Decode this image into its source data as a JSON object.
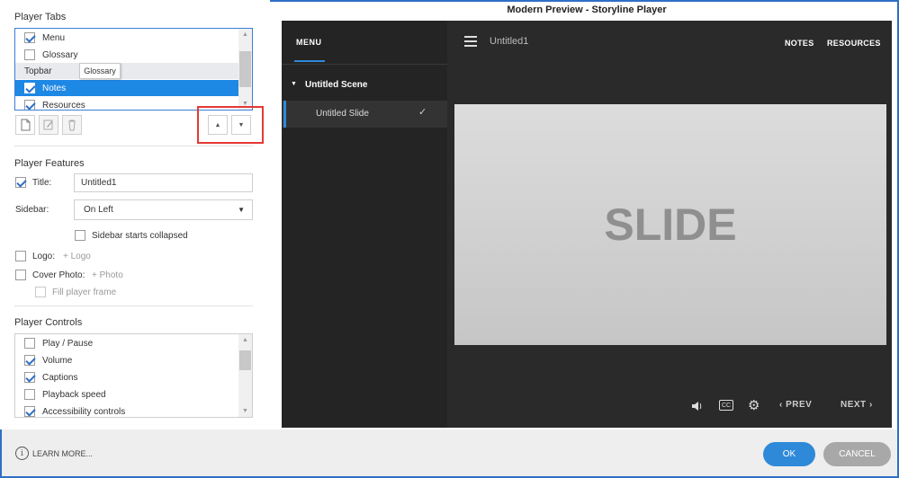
{
  "player_tabs": {
    "title": "Player Tabs",
    "items": [
      {
        "label": "Menu",
        "checked": true
      },
      {
        "label": "Glossary",
        "checked": false
      },
      {
        "label": "Topbar",
        "checked": null,
        "group": true
      },
      {
        "label": "Notes",
        "checked": true,
        "selected": true
      },
      {
        "label": "Resources",
        "checked": true
      }
    ],
    "tooltip": "Glossary"
  },
  "player_features": {
    "title": "Player Features",
    "title_label": "Title:",
    "title_value": "Untitled1",
    "title_checked": true,
    "sidebar_label": "Sidebar:",
    "sidebar_value": "On Left",
    "sidebar_collapsed_label": "Sidebar starts collapsed",
    "logo_label": "Logo:",
    "logo_action": "+ Logo",
    "cover_label": "Cover Photo:",
    "cover_action": "+ Photo",
    "fill_frame_label": "Fill player frame"
  },
  "player_controls": {
    "title": "Player Controls",
    "items": [
      {
        "label": "Play / Pause",
        "checked": false
      },
      {
        "label": "Volume",
        "checked": true
      },
      {
        "label": "Captions",
        "checked": true
      },
      {
        "label": "Playback speed",
        "checked": false
      },
      {
        "label": "Accessibility controls",
        "checked": true
      }
    ]
  },
  "preview": {
    "window_title": "Modern Preview - Storyline Player",
    "menu_tab": "MENU",
    "project_title": "Untitled1",
    "notes_tab": "NOTES",
    "resources_tab": "RESOURCES",
    "scene": "Untitled Scene",
    "slide": "Untitled Slide",
    "slide_text": "SLIDE",
    "prev": "PREV",
    "next": "NEXT",
    "cc": "CC"
  },
  "footer": {
    "learn_more": "LEARN MORE...",
    "ok": "OK",
    "cancel": "CANCEL"
  },
  "colors": {
    "accent": "#2e8ad8",
    "selection": "#1e88e5",
    "highlight_box": "#e53935",
    "player_bg": "#2a2a2a"
  }
}
